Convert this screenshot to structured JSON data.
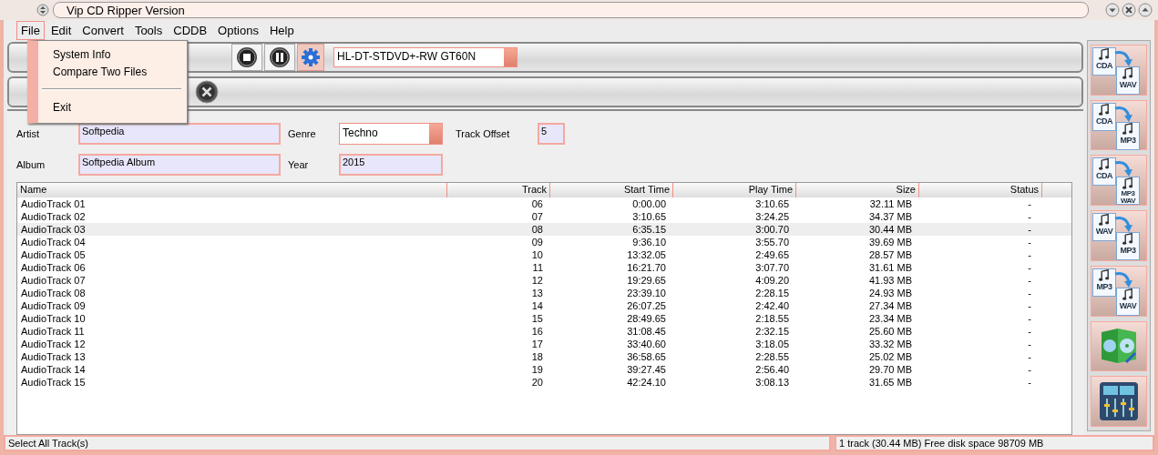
{
  "window": {
    "title": "Vip CD Ripper Version"
  },
  "menu": [
    {
      "label": "File",
      "selected": true
    },
    {
      "label": "Edit",
      "selected": false
    },
    {
      "label": "Convert",
      "selected": false
    },
    {
      "label": "Tools",
      "selected": false
    },
    {
      "label": "CDDB",
      "selected": false
    },
    {
      "label": "Options",
      "selected": false
    },
    {
      "label": "Help",
      "selected": false
    }
  ],
  "file_menu": [
    {
      "kind": "item",
      "label": "System Info"
    },
    {
      "kind": "item",
      "label": "Compare Two Files"
    },
    {
      "kind": "separator"
    },
    {
      "kind": "item",
      "label": "Exit"
    }
  ],
  "drive": {
    "value": "HL-DT-STDVD+-RW GT60N"
  },
  "fields": {
    "artist": {
      "label": "Artist",
      "value": "Softpedia"
    },
    "album": {
      "label": "Album",
      "value": "Softpedia Album"
    },
    "genre": {
      "label": "Genre",
      "value": "Techno"
    },
    "year": {
      "label": "Year",
      "value": "2015"
    },
    "track_offset": {
      "label": "Track Offset",
      "value": "5"
    }
  },
  "table": {
    "columns": [
      "Name",
      "Track",
      "Start Time",
      "Play Time",
      "Size",
      "Status"
    ],
    "rows": [
      {
        "cells": [
          "AudioTrack 01",
          "06",
          "0:00.00",
          "3:10.65",
          "32.11 MB",
          "-"
        ],
        "selected": false
      },
      {
        "cells": [
          "AudioTrack 02",
          "07",
          "3:10.65",
          "3:24.25",
          "34.37 MB",
          "-"
        ],
        "selected": false
      },
      {
        "cells": [
          "AudioTrack 03",
          "08",
          "6:35.15",
          "3:00.70",
          "30.44 MB",
          "-"
        ],
        "selected": true
      },
      {
        "cells": [
          "AudioTrack 04",
          "09",
          "9:36.10",
          "3:55.70",
          "39.69 MB",
          "-"
        ],
        "selected": false
      },
      {
        "cells": [
          "AudioTrack 05",
          "10",
          "13:32.05",
          "2:49.65",
          "28.57 MB",
          "-"
        ],
        "selected": false
      },
      {
        "cells": [
          "AudioTrack 06",
          "11",
          "16:21.70",
          "3:07.70",
          "31.61 MB",
          "-"
        ],
        "selected": false
      },
      {
        "cells": [
          "AudioTrack 07",
          "12",
          "19:29.65",
          "4:09.20",
          "41.93 MB",
          "-"
        ],
        "selected": false
      },
      {
        "cells": [
          "AudioTrack 08",
          "13",
          "23:39.10",
          "2:28.15",
          "24.93 MB",
          "-"
        ],
        "selected": false
      },
      {
        "cells": [
          "AudioTrack 09",
          "14",
          "26:07.25",
          "2:42.40",
          "27.34 MB",
          "-"
        ],
        "selected": false
      },
      {
        "cells": [
          "AudioTrack 10",
          "15",
          "28:49.65",
          "2:18.55",
          "23.34 MB",
          "-"
        ],
        "selected": false
      },
      {
        "cells": [
          "AudioTrack 11",
          "16",
          "31:08.45",
          "2:32.15",
          "25.60 MB",
          "-"
        ],
        "selected": false
      },
      {
        "cells": [
          "AudioTrack 12",
          "17",
          "33:40.60",
          "3:18.05",
          "33.32 MB",
          "-"
        ],
        "selected": false
      },
      {
        "cells": [
          "AudioTrack 13",
          "18",
          "36:58.65",
          "2:28.55",
          "25.02 MB",
          "-"
        ],
        "selected": false
      },
      {
        "cells": [
          "AudioTrack 14",
          "19",
          "39:27.45",
          "2:56.40",
          "29.70 MB",
          "-"
        ],
        "selected": false
      },
      {
        "cells": [
          "AudioTrack 15",
          "20",
          "42:24.10",
          "3:08.13",
          "31.65 MB",
          "-"
        ],
        "selected": false
      }
    ]
  },
  "sidebar": [
    {
      "kind": "convert",
      "from": "CDA",
      "to": "WAV"
    },
    {
      "kind": "convert",
      "from": "CDA",
      "to": "MP3"
    },
    {
      "kind": "convert",
      "from": "CDA",
      "to": "MP3 WAV"
    },
    {
      "kind": "convert",
      "from": "WAV",
      "to": "MP3"
    },
    {
      "kind": "convert",
      "from": "MP3",
      "to": "WAV"
    },
    {
      "kind": "cd-case"
    },
    {
      "kind": "mixer"
    }
  ],
  "status_bar": {
    "left": "Select All Track(s)",
    "right": "1 track (30.44 MB) Free disk space 98709 MB"
  }
}
